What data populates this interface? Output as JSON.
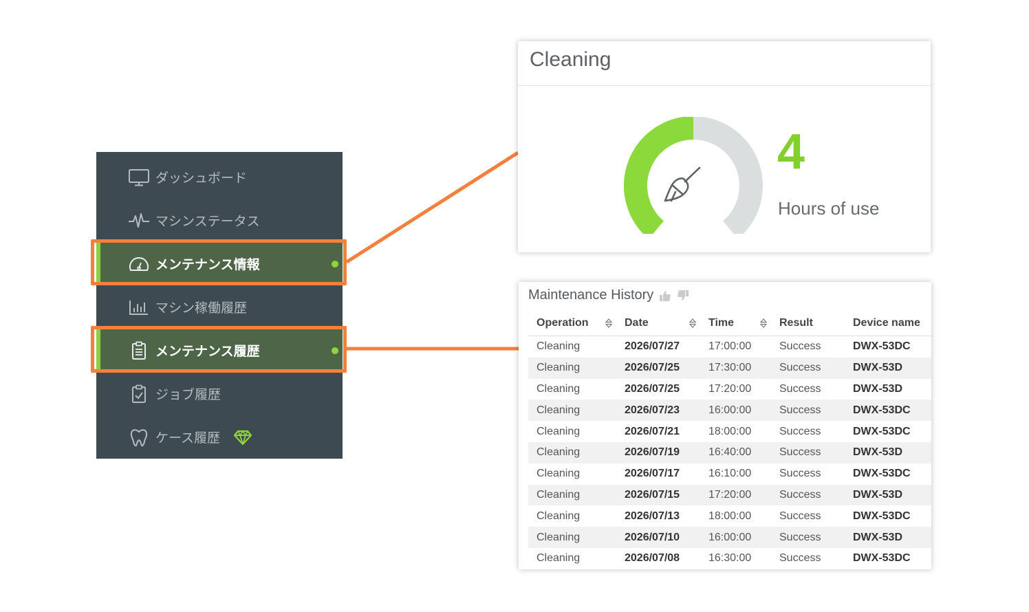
{
  "sidebar": {
    "items": [
      {
        "label": "ダッシュボード",
        "icon": "monitor-icon",
        "active": false
      },
      {
        "label": "マシンステータス",
        "icon": "pulse-icon",
        "active": false
      },
      {
        "label": "メンテナンス情報",
        "icon": "gauge-icon",
        "active": true
      },
      {
        "label": "マシン稼働履歴",
        "icon": "bar-chart-icon",
        "active": false
      },
      {
        "label": "メンテナンス履歴",
        "icon": "clipboard-list-icon",
        "active": true
      },
      {
        "label": "ジョブ履歴",
        "icon": "clipboard-check-icon",
        "active": false
      },
      {
        "label": "ケース履歴",
        "icon": "tooth-icon",
        "active": false,
        "badge": "diamond-icon"
      }
    ]
  },
  "cleaning": {
    "title": "Cleaning",
    "value": "4",
    "unit_label": "Hours of use",
    "gauge_fraction": 0.5,
    "icon": "brush-icon"
  },
  "history": {
    "title": "Maintenance History",
    "columns": [
      "Operation",
      "Date",
      "Time",
      "Result",
      "Device name"
    ],
    "rows": [
      [
        "Cleaning",
        "2026/07/27",
        "17:00:00",
        "Success",
        "DWX-53DC"
      ],
      [
        "Cleaning",
        "2026/07/25",
        "17:30:00",
        "Success",
        "DWX-53D"
      ],
      [
        "Cleaning",
        "2026/07/25",
        "17:20:00",
        "Success",
        "DWX-53D"
      ],
      [
        "Cleaning",
        "2026/07/23",
        "16:00:00",
        "Success",
        "DWX-53DC"
      ],
      [
        "Cleaning",
        "2026/07/21",
        "18:00:00",
        "Success",
        "DWX-53DC"
      ],
      [
        "Cleaning",
        "2026/07/19",
        "16:40:00",
        "Success",
        "DWX-53D"
      ],
      [
        "Cleaning",
        "2026/07/17",
        "16:10:00",
        "Success",
        "DWX-53DC"
      ],
      [
        "Cleaning",
        "2026/07/15",
        "17:20:00",
        "Success",
        "DWX-53D"
      ],
      [
        "Cleaning",
        "2026/07/13",
        "18:00:00",
        "Success",
        "DWX-53DC"
      ],
      [
        "Cleaning",
        "2026/07/10",
        "16:00:00",
        "Success",
        "DWX-53D"
      ],
      [
        "Cleaning",
        "2026/07/08",
        "16:30:00",
        "Success",
        "DWX-53DC"
      ]
    ]
  },
  "colors": {
    "sidebar_bg": "#3e4a52",
    "active_bg": "#4e6547",
    "accent_green": "#82d12a",
    "highlight_orange": "#f57f3b"
  }
}
